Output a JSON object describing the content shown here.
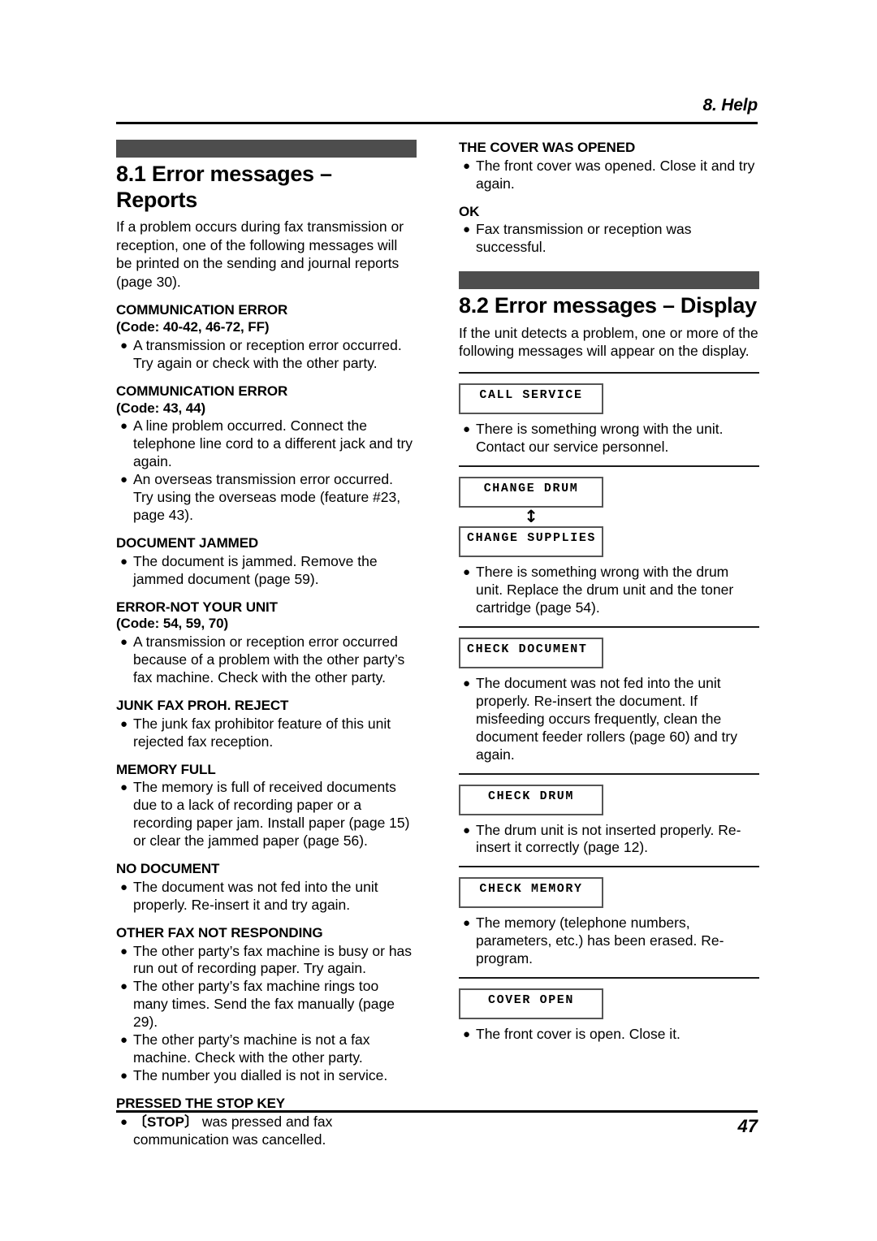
{
  "header": {
    "chapter_label": "8. Help"
  },
  "footer": {
    "page_number": "47"
  },
  "colors": {
    "section_bar": "#4d4d4d",
    "rule": "#000000",
    "lcd_border": "#555555"
  },
  "left_column": {
    "section": {
      "title": "8.1 Error messages – Reports",
      "intro": "If a problem occurs during fax transmission or reception, one of the following messages will be printed on the sending and journal reports (page 30)."
    },
    "messages": [
      {
        "title": "COMMUNICATION ERROR",
        "code": "(Code: 40-42, 46-72, FF)",
        "bullets": [
          "A transmission or reception error occurred. Try again or check with the other party."
        ]
      },
      {
        "title": "COMMUNICATION ERROR",
        "code": "(Code: 43, 44)",
        "bullets": [
          "A line problem occurred. Connect the telephone line cord to a different jack and try again.",
          "An overseas transmission error occurred. Try using the overseas mode (feature #23, page 43)."
        ]
      },
      {
        "title": "DOCUMENT JAMMED",
        "code": "",
        "bullets": [
          "The document is jammed. Remove the jammed document (page 59)."
        ]
      },
      {
        "title": "ERROR-NOT YOUR UNIT",
        "code": "(Code: 54, 59, 70)",
        "bullets": [
          "A transmission or reception error occurred because of a problem with the other party’s fax machine. Check with the other party."
        ]
      },
      {
        "title": "JUNK FAX PROH. REJECT",
        "code": "",
        "bullets": [
          "The junk fax prohibitor feature of this unit rejected fax reception."
        ]
      },
      {
        "title": "MEMORY FULL",
        "code": "",
        "bullets": [
          "The memory is full of received documents due to a lack of recording paper or a recording paper jam. Install paper (page 15) or clear the jammed paper (page 56)."
        ]
      },
      {
        "title": "NO DOCUMENT",
        "code": "",
        "bullets": [
          "The document was not fed into the unit properly. Re-insert it and try again."
        ]
      },
      {
        "title": "OTHER FAX NOT RESPONDING",
        "code": "",
        "bullets": [
          "The other party’s fax machine is busy or has run out of recording paper. Try again.",
          "The other party’s fax machine rings too many times. Send the fax manually (page 29).",
          "The other party’s machine is not a fax machine. Check with the other party.",
          "The number you dialled is not in service."
        ]
      },
      {
        "title": "PRESSED THE STOP KEY",
        "code": "",
        "stop_key_label": "STOP",
        "bullets_after_key": [
          "was pressed and fax communication was cancelled."
        ],
        "bullets": []
      }
    ]
  },
  "right_column": {
    "continued_messages": [
      {
        "title": "THE COVER WAS OPENED",
        "bullets": [
          "The front cover was opened. Close it and try again."
        ]
      },
      {
        "title": "OK",
        "bullets": [
          "Fax transmission or reception was successful."
        ]
      }
    ],
    "section": {
      "title": "8.2 Error messages – Display",
      "intro": "If the unit detects a problem, one or more of the following messages will appear on the display."
    },
    "display_messages": [
      {
        "lcd": [
          "CALL SERVICE"
        ],
        "arrow": false,
        "align": "center",
        "bullets": [
          "There is something wrong with the unit. Contact our service personnel."
        ]
      },
      {
        "lcd": [
          "CHANGE DRUM",
          "CHANGE SUPPLIES"
        ],
        "arrow": true,
        "arrow_glyph": "↕",
        "align": "mixed",
        "bullets": [
          "There is something wrong with the drum unit. Replace the drum unit and the toner cartridge (page 54)."
        ]
      },
      {
        "lcd": [
          "CHECK DOCUMENT"
        ],
        "arrow": false,
        "align": "left",
        "bullets": [
          "The document was not fed into the unit properly. Re-insert the document. If misfeeding occurs frequently, clean the document feeder rollers (page 60) and try again."
        ]
      },
      {
        "lcd": [
          "CHECK DRUM"
        ],
        "arrow": false,
        "align": "center",
        "bullets": [
          "The drum unit is not inserted properly. Re-insert it correctly (page 12)."
        ]
      },
      {
        "lcd": [
          "CHECK MEMORY"
        ],
        "arrow": false,
        "align": "center",
        "bullets": [
          "The memory (telephone numbers, parameters, etc.) has been erased. Re-program."
        ]
      },
      {
        "lcd": [
          "COVER OPEN"
        ],
        "arrow": false,
        "align": "center",
        "bullets": [
          "The front cover is open. Close it."
        ]
      }
    ]
  }
}
